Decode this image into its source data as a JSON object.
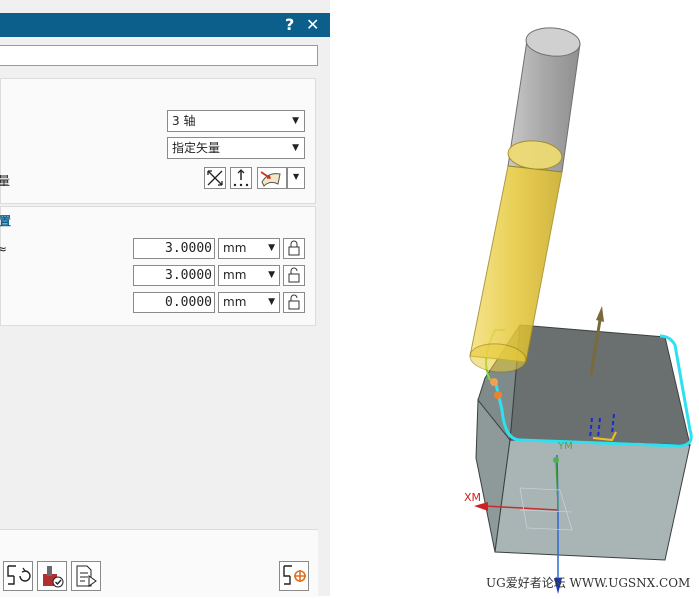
{
  "dialog": {
    "help_glyph": "?",
    "close_glyph": "✕",
    "name_value": ""
  },
  "axis_group": {
    "axis_option": "3 轴",
    "direction_option": "指定矢量",
    "vector_label": "量"
  },
  "position_group": {
    "header": "置",
    "row_label_1": "≈",
    "fields": [
      {
        "value": "3.0000",
        "unit": "mm"
      },
      {
        "value": "3.0000",
        "unit": "mm"
      },
      {
        "value": "0.0000",
        "unit": "mm"
      }
    ]
  },
  "scene": {
    "axis_x_label": "XM",
    "axis_y_label": "YM",
    "tool_color": "#e8cc3a",
    "block_top_color": "#6a7070",
    "block_front_color": "#a9b4b4",
    "path_color": "#2ee0f0"
  },
  "watermark": "UG爱好者论坛 WWW.UGSNX.COM"
}
